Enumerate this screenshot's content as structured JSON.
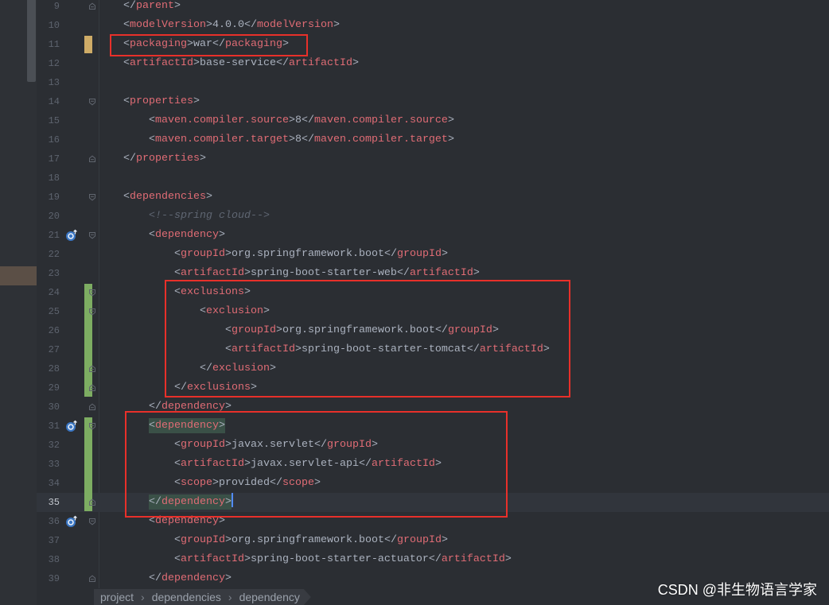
{
  "editor": {
    "lines": [
      {
        "num": "9",
        "text": "    </parent>",
        "fold_icon": "fold-end-icon"
      },
      {
        "num": "10",
        "text": "    <modelVersion>4.0.0</modelVersion>"
      },
      {
        "num": "11",
        "text": "    <packaging>war</packaging>",
        "change_marker": "modified-line-marker"
      },
      {
        "num": "12",
        "text": "    <artifactId>base-service</artifactId>"
      },
      {
        "num": "13",
        "text": ""
      },
      {
        "num": "14",
        "text": "    <properties>",
        "fold_icon": "fold-start-icon"
      },
      {
        "num": "15",
        "text": "        <maven.compiler.source>8</maven.compiler.source>"
      },
      {
        "num": "16",
        "text": "        <maven.compiler.target>8</maven.compiler.target>"
      },
      {
        "num": "17",
        "text": "    </properties>",
        "fold_icon": "fold-end-icon"
      },
      {
        "num": "18",
        "text": ""
      },
      {
        "num": "19",
        "text": "    <dependencies>",
        "fold_icon": "fold-start-icon"
      },
      {
        "num": "20",
        "text": "        <!--spring cloud-->"
      },
      {
        "num": "21",
        "text": "        <dependency>",
        "gutter_icon": "maven-dependency-icon",
        "fold_icon": "fold-start-icon"
      },
      {
        "num": "22",
        "text": "            <groupId>org.springframework.boot</groupId>"
      },
      {
        "num": "23",
        "text": "            <artifactId>spring-boot-starter-web</artifactId>"
      },
      {
        "num": "24",
        "text": "            <exclusions>",
        "change_marker": "added-line-marker",
        "fold_icon": "fold-start-icon"
      },
      {
        "num": "25",
        "text": "                <exclusion>",
        "change_marker": "added-line-marker",
        "fold_icon": "fold-start-icon"
      },
      {
        "num": "26",
        "text": "                    <groupId>org.springframework.boot</groupId>",
        "change_marker": "added-line-marker"
      },
      {
        "num": "27",
        "text": "                    <artifactId>spring-boot-starter-tomcat</artifactId>",
        "change_marker": "added-line-marker"
      },
      {
        "num": "28",
        "text": "                </exclusion>",
        "change_marker": "added-line-marker",
        "fold_icon": "fold-end-icon"
      },
      {
        "num": "29",
        "text": "            </exclusions>",
        "change_marker": "added-line-marker",
        "fold_icon": "fold-end-icon"
      },
      {
        "num": "30",
        "text": "        </dependency>",
        "fold_icon": "fold-end-icon"
      },
      {
        "num": "31",
        "text": "        <dependency>",
        "gutter_icon": "maven-dependency-icon",
        "change_marker": "added-line-marker",
        "fold_icon": "fold-start-icon",
        "brace_match": true
      },
      {
        "num": "32",
        "text": "            <groupId>javax.servlet</groupId>",
        "change_marker": "added-line-marker"
      },
      {
        "num": "33",
        "text": "            <artifactId>javax.servlet-api</artifactId>",
        "change_marker": "added-line-marker"
      },
      {
        "num": "34",
        "text": "            <scope>provided</scope>",
        "change_marker": "added-line-marker"
      },
      {
        "num": "35",
        "text": "        </dependency>",
        "change_marker": "added-line-marker",
        "fold_icon": "fold-end-icon",
        "brace_match": true,
        "current": true,
        "caret": true
      },
      {
        "num": "36",
        "text": "        <dependency>",
        "gutter_icon": "maven-dependency-icon",
        "fold_icon": "fold-start-icon"
      },
      {
        "num": "37",
        "text": "            <groupId>org.springframework.boot</groupId>"
      },
      {
        "num": "38",
        "text": "            <artifactId>spring-boot-starter-actuator</artifactId>"
      },
      {
        "num": "39",
        "text": "        </dependency>",
        "fold_icon": "fold-end-icon"
      }
    ]
  },
  "breadcrumb": {
    "items": [
      "project",
      "dependencies",
      "dependency"
    ],
    "separator": "›"
  },
  "watermark": "CSDN @非生物语言学家",
  "colors": {
    "editor_bg": "#2b2e33",
    "text": "#abb2bf",
    "tag": "#e06c75",
    "comment": "#5f6672",
    "line_number": "#5d636e",
    "line_number_current": "#c4c8cf",
    "current_line_bg": "#31353c",
    "brace_match_bg": "#3a5047",
    "caret": "#528bff",
    "modified_marker": "#cfac67",
    "added_marker": "#7dad62",
    "annotation": "#e8302a"
  }
}
